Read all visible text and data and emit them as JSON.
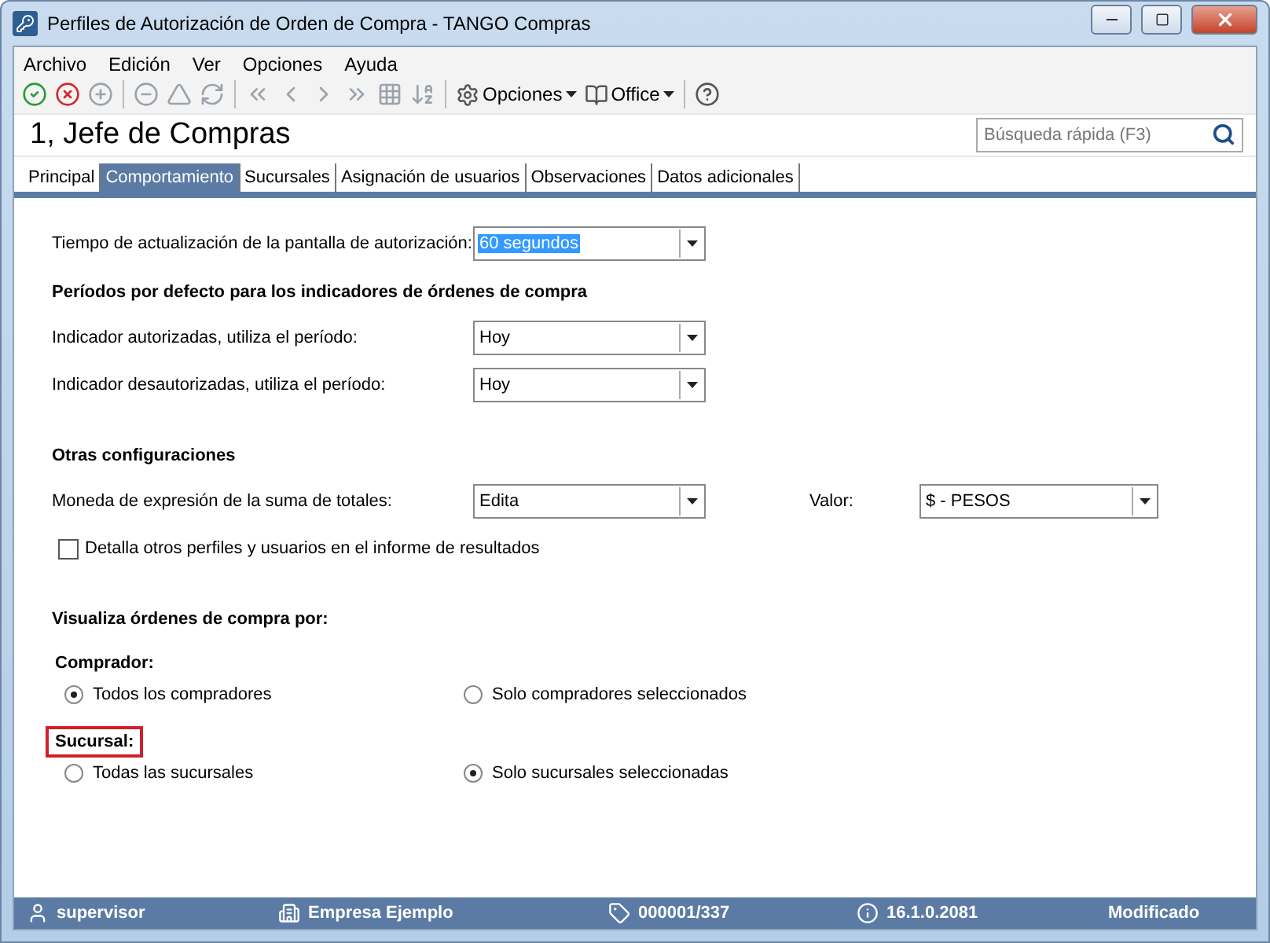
{
  "window": {
    "title": "Perfiles de Autorización de Orden de Compra - TANGO Compras"
  },
  "menu": [
    "Archivo",
    "Edición",
    "Ver",
    "Opciones",
    "Ayuda"
  ],
  "toolbar": {
    "options_label": "Opciones",
    "office_label": "Office"
  },
  "record_title": "1, Jefe de Compras",
  "search": {
    "placeholder": "Búsqueda rápida (F3)"
  },
  "tabs": [
    {
      "label": "Principal",
      "selected": false
    },
    {
      "label": "Comportamiento",
      "selected": true
    },
    {
      "label": "Sucursales",
      "selected": false
    },
    {
      "label": "Asignación de usuarios",
      "selected": false
    },
    {
      "label": "Observaciones",
      "selected": false
    },
    {
      "label": "Datos adicionales",
      "selected": false
    }
  ],
  "refresh": {
    "label": "Tiempo de actualización de la pantalla de autorización:",
    "value": "60 segundos",
    "highlighted": true
  },
  "periods": {
    "heading": "Períodos por defecto para los indicadores de órdenes de compra",
    "fields": [
      {
        "label": "Indicador autorizadas, utiliza el período:",
        "value": "Hoy"
      },
      {
        "label": "Indicador desautorizadas, utiliza el período:",
        "value": "Hoy"
      }
    ]
  },
  "other": {
    "heading": "Otras configuraciones",
    "currency": {
      "label": "Moneda de expresión de la suma de totales:",
      "value": "Edita"
    },
    "amount": {
      "label": "Valor:",
      "value": "$ - PESOS"
    },
    "detail": {
      "label": "Detalla otros perfiles y usuarios en el informe de resultados",
      "checked": false
    }
  },
  "view": {
    "heading": "Visualiza órdenes de compra por:",
    "groups": [
      {
        "label": "Comprador:",
        "highlighted": false,
        "options": [
          {
            "label": "Todos los compradores",
            "selected": true
          },
          {
            "label": "Solo compradores seleccionados",
            "selected": false
          }
        ]
      },
      {
        "label": "Sucursal:",
        "highlighted": true,
        "options": [
          {
            "label": "Todas las sucursales",
            "selected": false
          },
          {
            "label": "Solo sucursales seleccionadas",
            "selected": true
          }
        ]
      }
    ]
  },
  "status_bar": {
    "user": "supervisor",
    "company": "Empresa Ejemplo",
    "license": "000001/337",
    "version": "16.1.0.2081",
    "state": "Modificado"
  }
}
